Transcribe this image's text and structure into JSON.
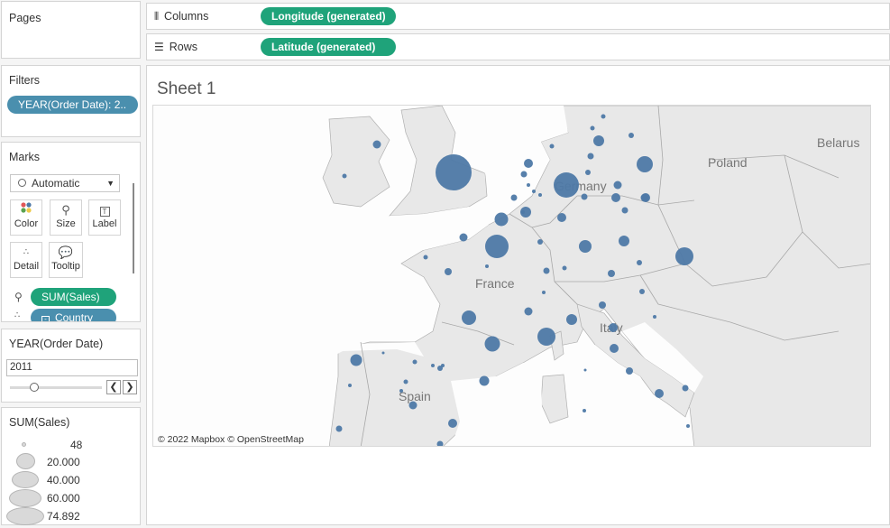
{
  "pages": {
    "title": "Pages"
  },
  "shelves": {
    "columns": {
      "label": "Columns",
      "icon": "columns-icon",
      "pill": "Longitude (generated)"
    },
    "rows": {
      "label": "Rows",
      "icon": "rows-icon",
      "pill": "Latitude (generated)"
    }
  },
  "filters": {
    "title": "Filters",
    "pill": "YEAR(Order Date): 2.."
  },
  "marks": {
    "title": "Marks",
    "mark_type": "Automatic",
    "buttons": {
      "color": "Color",
      "size": "Size",
      "label": "Label",
      "detail": "Detail",
      "tooltip": "Tooltip"
    },
    "fields": {
      "size_field": "SUM(Sales)",
      "detail_field": "Country"
    }
  },
  "year_filter": {
    "title": "YEAR(Order Date)",
    "value": "2011"
  },
  "size_legend": {
    "title": "SUM(Sales)",
    "entries": [
      "48",
      "20.000",
      "40.000",
      "60.000",
      "74.892"
    ]
  },
  "sheet": {
    "title": "Sheet 1"
  },
  "map": {
    "labels": {
      "belarus": "Belarus",
      "poland": "Poland",
      "germany": "Germany",
      "france": "France",
      "italy": "Italy",
      "spain": "Spain"
    },
    "attribution": "© 2022 Mapbox © OpenStreetMap",
    "mark_color": "#4e79a7",
    "land_color": "#e8e8e8",
    "border_color": "#a0a0a0"
  },
  "colors": {
    "green_pill": "#1fa37a",
    "blue_pill": "#4a8fae"
  }
}
